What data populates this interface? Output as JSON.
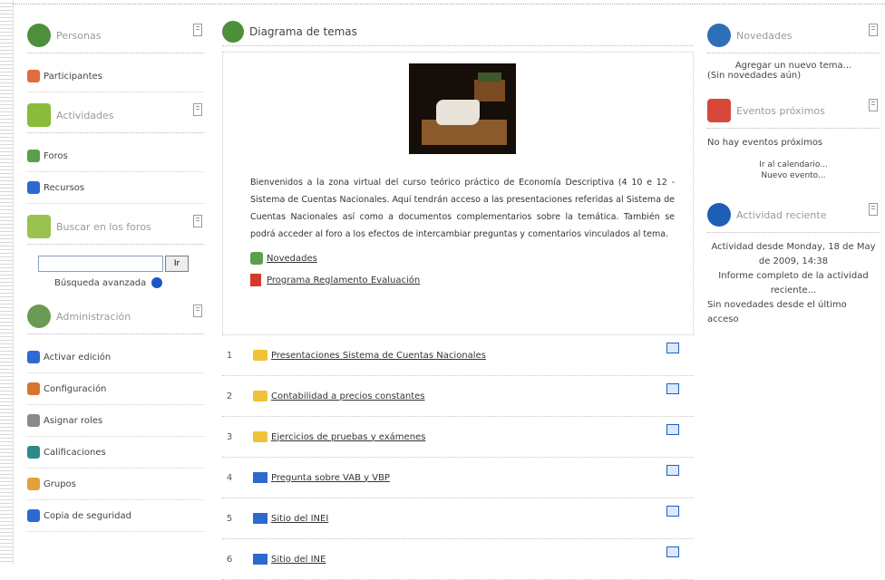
{
  "left": {
    "personas_title": "Personas",
    "participantes": "Participantes",
    "actividades_title": "Actividades",
    "foros": "Foros",
    "recursos": "Recursos",
    "buscar_title": "Buscar en los foros",
    "search_button": "Ir",
    "busqueda_avanzada": "Búsqueda avanzada",
    "admin_title": "Administración",
    "admin_items": [
      "Activar edición",
      "Configuración",
      "Asignar roles",
      "Calificaciones",
      "Grupos",
      "Copia de seguridad"
    ]
  },
  "center": {
    "title": "Diagrama de temas",
    "welcome": "Bienvenidos a la zona virtual del curso teórico práctico de Economía Descriptiva (4 10 e 12 - Sistema de Cuentas Nacionales. Aquí tendrán acceso a las presentaciones referidas al Sistema de Cuentas Nacionales así como a documentos complementarios sobre la temática. También se podrá acceder al foro a los efectos de intercambiar preguntas y comentarios vinculados al tema.",
    "links": [
      "Novedades",
      "Programa Reglamento Evaluación"
    ],
    "topics": [
      {
        "num": "1",
        "label": "Presentaciones Sistema de Cuentas Nacionales"
      },
      {
        "num": "2",
        "label": "Contabilidad a precios constantes"
      },
      {
        "num": "3",
        "label": "Ejercicios de pruebas y exámenes"
      },
      {
        "num": "4",
        "label": "Pregunta sobre VAB y VBP"
      },
      {
        "num": "5",
        "label": "Sitio del INEI"
      },
      {
        "num": "6",
        "label": "Sitio del INE"
      }
    ]
  },
  "right": {
    "novedades_title": "Novedades",
    "agregar": "Agregar un nuevo tema...",
    "sin_novedades": "(Sin novedades aún)",
    "eventos_title": "Eventos próximos",
    "no_eventos": "No hay eventos próximos",
    "ir_calendario": "Ir al calendario...",
    "nuevo_evento": "Nuevo evento...",
    "actividad_title": "Actividad reciente",
    "actividad_desde": "Actividad desde Monday, 18 de May de 2009, 14:38",
    "informe": "Informe completo de la actividad reciente...",
    "sin_novedades_ultimo": "Sin novedades desde el último acceso"
  },
  "colors": {
    "link_blue": "#1c56c6",
    "folder": "#f0c23a"
  }
}
